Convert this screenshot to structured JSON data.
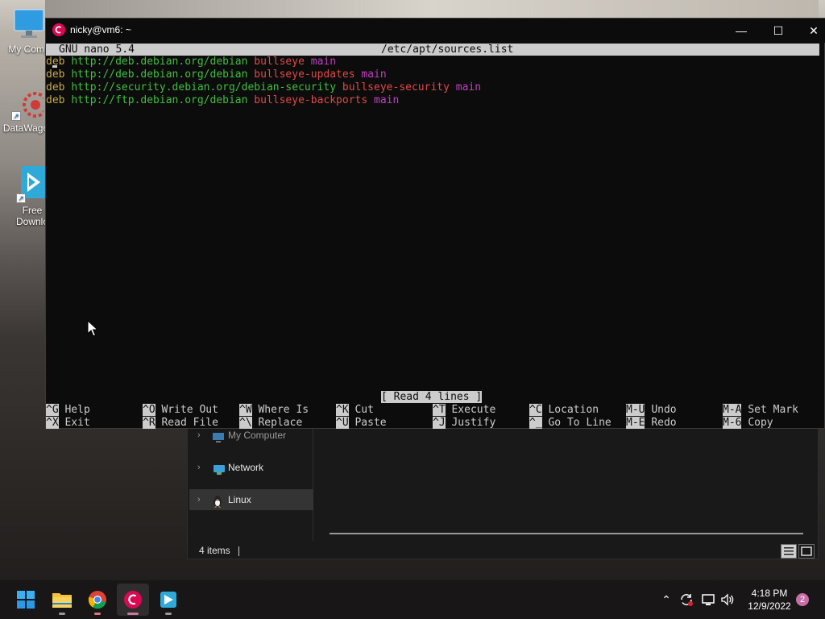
{
  "desktop": {
    "icons": [
      {
        "label": "My Comp",
        "icon": "computer-icon"
      },
      {
        "label": "DataWago",
        "icon": "datawagon-icon"
      },
      {
        "label": "Free Downlo",
        "icon": "free-download-icon"
      }
    ]
  },
  "terminal": {
    "title": "nicky@vm6: ~",
    "icon": "debian-icon",
    "controls": {
      "minimize": "—",
      "maximize": "☐",
      "close": "✕"
    },
    "nano": {
      "version": "GNU nano 5.4",
      "filename": "/etc/apt/sources.list",
      "lines": [
        {
          "type": "deb",
          "url": "http://deb.debian.org/debian",
          "suite": "bullseye",
          "component": "main"
        },
        {
          "type": "deb",
          "url": "http://deb.debian.org/debian",
          "suite": "bullseye-updates",
          "component": "main"
        },
        {
          "type": "deb",
          "url": "http://security.debian.org/debian-security",
          "suite": "bullseye-security",
          "component": "main"
        },
        {
          "type": "deb",
          "url": "http://ftp.debian.org/debian",
          "suite": "bullseye-backports",
          "component": "main"
        }
      ],
      "status_message": "[ Read 4 lines ]",
      "shortcuts_row1": [
        {
          "key": "^G",
          "label": "Help"
        },
        {
          "key": "^O",
          "label": "Write Out"
        },
        {
          "key": "^W",
          "label": "Where Is"
        },
        {
          "key": "^K",
          "label": "Cut"
        },
        {
          "key": "^T",
          "label": "Execute"
        },
        {
          "key": "^C",
          "label": "Location"
        },
        {
          "key": "M-U",
          "label": "Undo"
        },
        {
          "key": "M-A",
          "label": "Set Mark"
        }
      ],
      "shortcuts_row2": [
        {
          "key": "^X",
          "label": "Exit"
        },
        {
          "key": "^R",
          "label": "Read File"
        },
        {
          "key": "^\\",
          "label": "Replace"
        },
        {
          "key": "^U",
          "label": "Paste"
        },
        {
          "key": "^J",
          "label": "Justify"
        },
        {
          "key": "^_",
          "label": "Go To Line"
        },
        {
          "key": "M-E",
          "label": "Redo"
        },
        {
          "key": "M-6",
          "label": "Copy"
        }
      ],
      "colors": {
        "keyword": "#c8a94a",
        "url": "#3fbf3f",
        "suite": "#e04848",
        "component": "#c040c0"
      }
    }
  },
  "explorer": {
    "nav_items": [
      {
        "label": "My Computer",
        "icon": "computer-icon"
      },
      {
        "label": "Network",
        "icon": "network-icon"
      },
      {
        "label": "Linux",
        "icon": "linux-penguin-icon"
      }
    ],
    "status": "4 items"
  },
  "taskbar": {
    "apps": [
      "start-icon",
      "file-explorer-icon",
      "chrome-icon",
      "debian-terminal-icon",
      "free-download-manager-icon"
    ],
    "clock_time": "4:18 PM",
    "clock_date": "12/9/2022",
    "notification_count": "2"
  }
}
